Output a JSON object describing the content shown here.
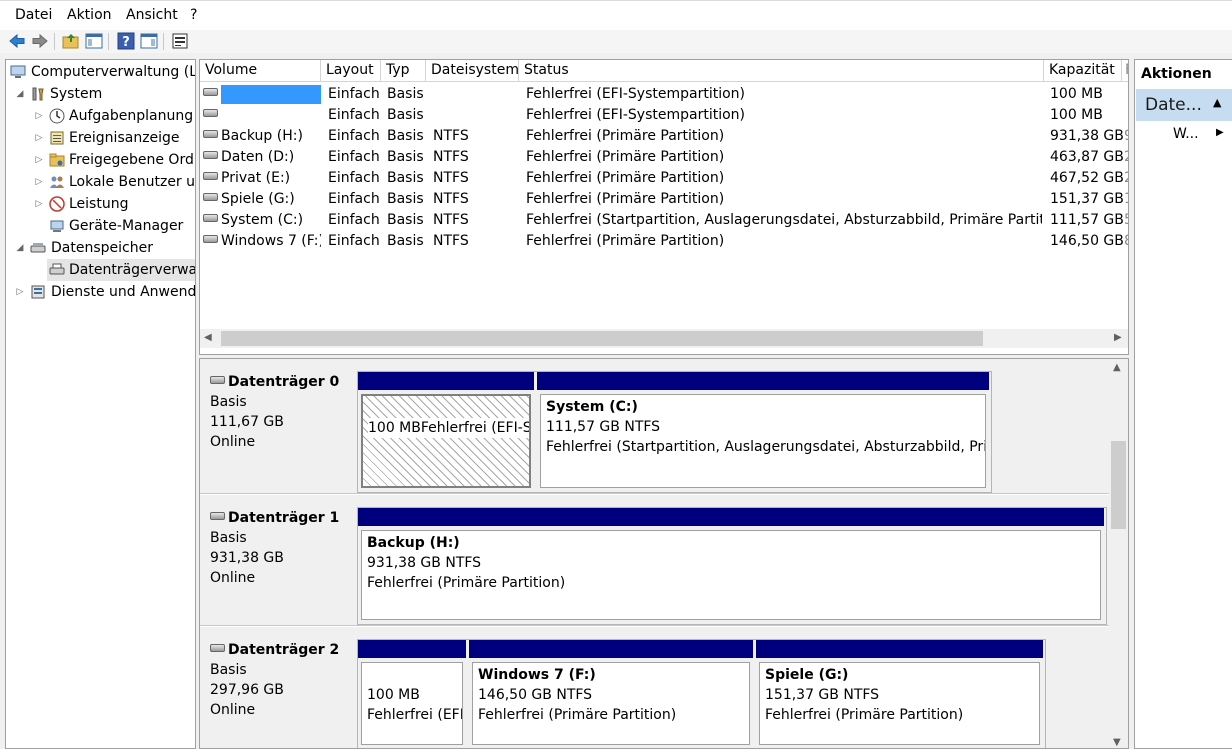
{
  "menu": {
    "items": [
      "Datei",
      "Aktion",
      "Ansicht",
      "?"
    ]
  },
  "tree": {
    "items": [
      {
        "label": "Computerverwaltung (Lo",
        "icon": "computer-management-icon"
      },
      {
        "label": "System",
        "icon": "tools-icon"
      },
      {
        "label": "Aufgabenplanung",
        "icon": "clock-icon"
      },
      {
        "label": "Ereignisanzeige",
        "icon": "event-viewer-icon"
      },
      {
        "label": "Freigegebene Ordn",
        "icon": "shared-folder-icon"
      },
      {
        "label": "Lokale Benutzer un",
        "icon": "users-icon"
      },
      {
        "label": "Leistung",
        "icon": "performance-icon"
      },
      {
        "label": "Geräte-Manager",
        "icon": "device-manager-icon"
      },
      {
        "label": "Datenspeicher",
        "icon": "storage-icon"
      },
      {
        "label": "Datenträgerverwalt",
        "icon": "disk-management-icon"
      },
      {
        "label": "Dienste und Anwendu",
        "icon": "services-icon"
      }
    ]
  },
  "volumes": {
    "columns": [
      "Volume",
      "Layout",
      "Typ",
      "Dateisystem",
      "Status",
      "Kapazität",
      "F"
    ],
    "rows": [
      {
        "volume": "",
        "layout": "Einfach",
        "typ": "Basis",
        "fs": "",
        "status": "Fehlerfrei (EFI-Systempartition)",
        "kap": "100 MB",
        "extra": "",
        "selected": true
      },
      {
        "volume": "",
        "layout": "Einfach",
        "typ": "Basis",
        "fs": "",
        "status": "Fehlerfrei (EFI-Systempartition)",
        "kap": "100 MB",
        "extra": ""
      },
      {
        "volume": "Backup (H:)",
        "layout": "Einfach",
        "typ": "Basis",
        "fs": "NTFS",
        "status": "Fehlerfrei (Primäre Partition)",
        "kap": "931,38 GB",
        "extra": "9"
      },
      {
        "volume": "Daten (D:)",
        "layout": "Einfach",
        "typ": "Basis",
        "fs": "NTFS",
        "status": "Fehlerfrei (Primäre Partition)",
        "kap": "463,87 GB",
        "extra": "2"
      },
      {
        "volume": "Privat (E:)",
        "layout": "Einfach",
        "typ": "Basis",
        "fs": "NTFS",
        "status": "Fehlerfrei (Primäre Partition)",
        "kap": "467,52 GB",
        "extra": "2"
      },
      {
        "volume": "Spiele (G:)",
        "layout": "Einfach",
        "typ": "Basis",
        "fs": "NTFS",
        "status": "Fehlerfrei (Primäre Partition)",
        "kap": "151,37 GB",
        "extra": "1"
      },
      {
        "volume": "System (C:)",
        "layout": "Einfach",
        "typ": "Basis",
        "fs": "NTFS",
        "status": "Fehlerfrei (Startpartition, Auslagerungsdatei, Absturzabbild, Primäre Partition)",
        "kap": "111,57 GB",
        "extra": "5"
      },
      {
        "volume": "Windows 7 (F:)",
        "layout": "Einfach",
        "typ": "Basis",
        "fs": "NTFS",
        "status": "Fehlerfrei (Primäre Partition)",
        "kap": "146,50 GB",
        "extra": "8"
      }
    ]
  },
  "disks": [
    {
      "name": "Datenträger 0",
      "type": "Basis",
      "size": "111,67 GB",
      "state": "Online",
      "parts": [
        {
          "title": "",
          "size": "100 MB",
          "status": "Fehlerfrei (EFI-Systempar",
          "hatched": true
        },
        {
          "title": "System  (C:)",
          "size": "111,57 GB NTFS",
          "status": "Fehlerfrei (Startpartition, Auslagerungsdatei, Absturzabbild, Primär"
        }
      ]
    },
    {
      "name": "Datenträger 1",
      "type": "Basis",
      "size": "931,38 GB",
      "state": "Online",
      "parts": [
        {
          "title": "Backup  (H:)",
          "size": "931,38 GB NTFS",
          "status": "Fehlerfrei (Primäre Partition)"
        }
      ]
    },
    {
      "name": "Datenträger 2",
      "type": "Basis",
      "size": "297,96 GB",
      "state": "Online",
      "parts": [
        {
          "title": "",
          "size": "100 MB",
          "status": "Fehlerfrei (EFI-"
        },
        {
          "title": "Windows 7  (F:)",
          "size": "146,50 GB NTFS",
          "status": "Fehlerfrei (Primäre Partition)"
        },
        {
          "title": "Spiele  (G:)",
          "size": "151,37 GB NTFS",
          "status": "Fehlerfrei (Primäre Partition)"
        }
      ]
    }
  ],
  "actions": {
    "header": "Aktionen",
    "group": "Date...",
    "item": "W..."
  },
  "colors": {
    "selection": "#3399ff",
    "partition_bar": "#00007f",
    "actions_group": "#c6dcf0"
  }
}
